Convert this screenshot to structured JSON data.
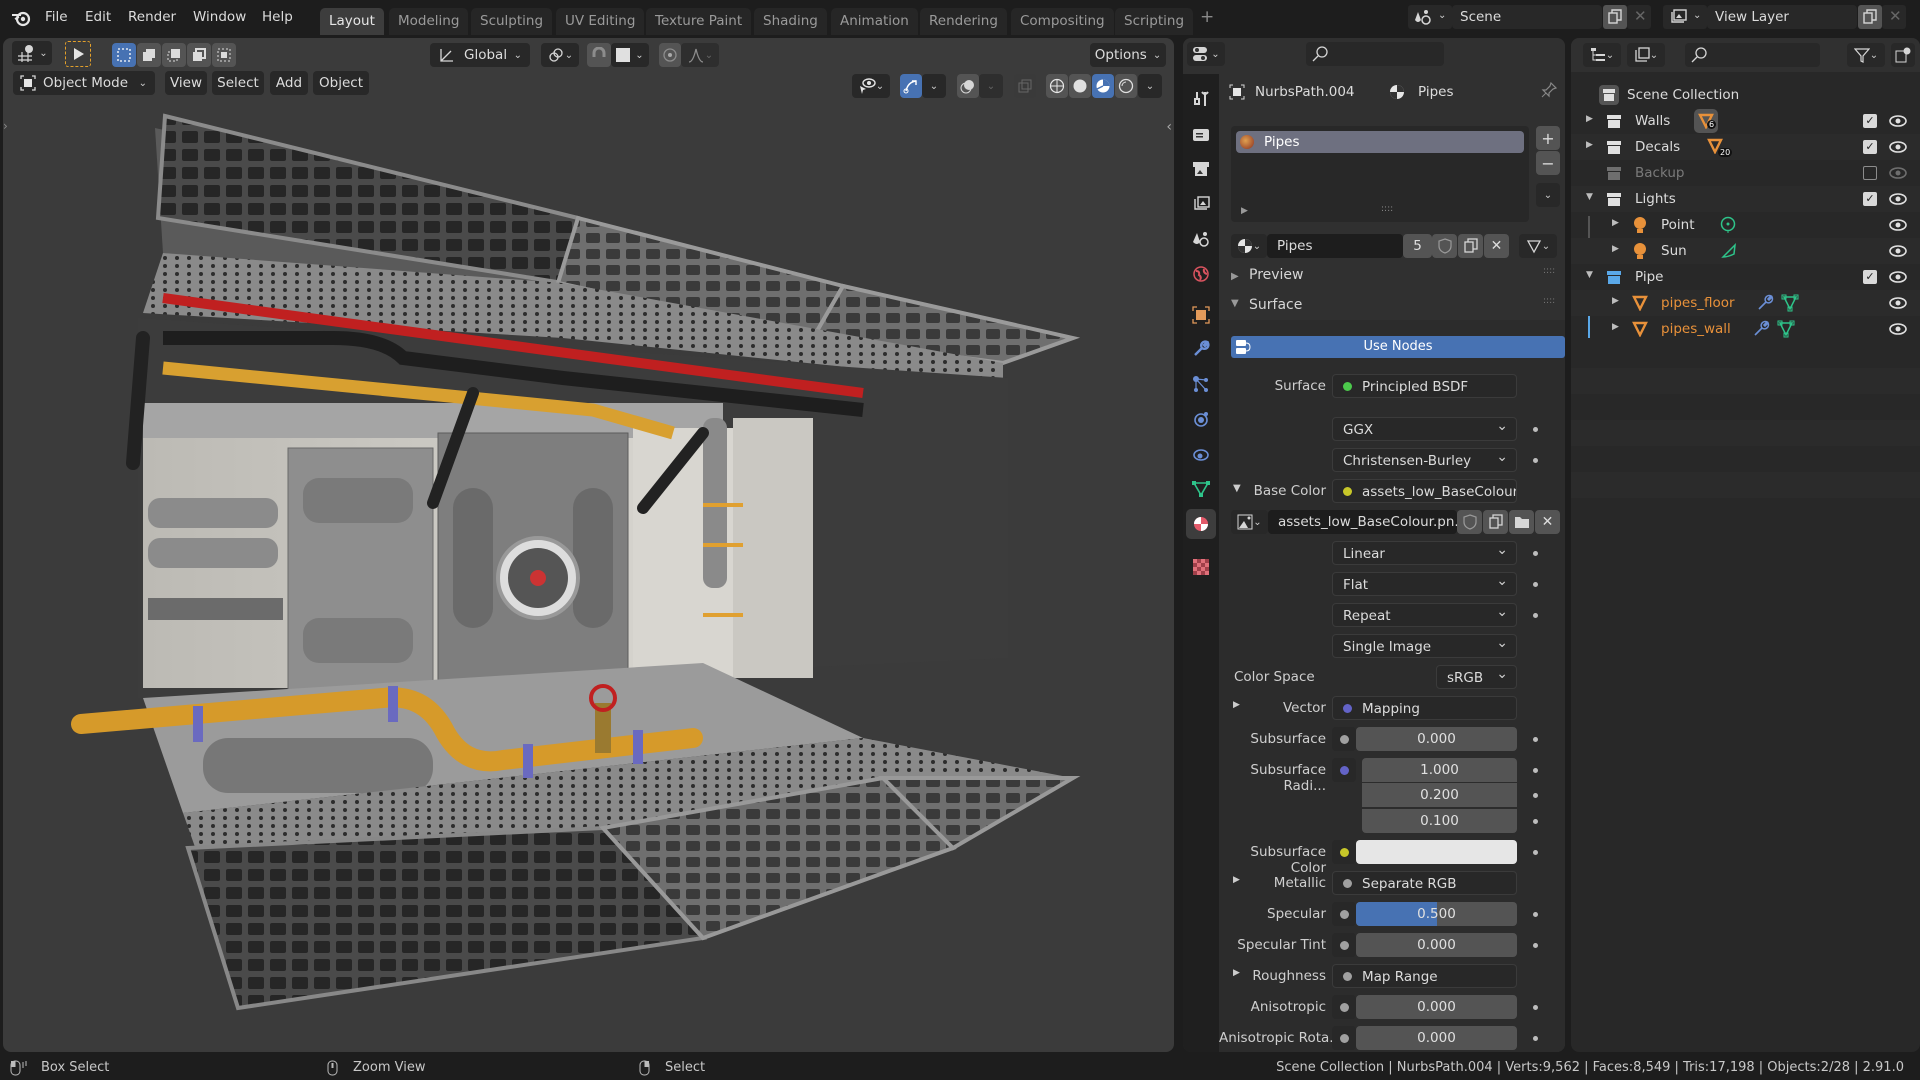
{
  "app": {
    "name": "Blender",
    "version": "2.91.0"
  },
  "menu": [
    "File",
    "Edit",
    "Render",
    "Window",
    "Help"
  ],
  "workspaces": [
    {
      "label": "Layout",
      "active": true
    },
    {
      "label": "Modeling"
    },
    {
      "label": "Sculpting"
    },
    {
      "label": "UV Editing"
    },
    {
      "label": "Texture Paint"
    },
    {
      "label": "Shading"
    },
    {
      "label": "Animation"
    },
    {
      "label": "Rendering"
    },
    {
      "label": "Compositing"
    },
    {
      "label": "Scripting"
    }
  ],
  "add_workspace": "+",
  "scene": {
    "name": "Scene",
    "view_layer": "View Layer"
  },
  "viewport": {
    "transform_orientation": "Global",
    "options_label": "Options",
    "mode": "Object Mode",
    "menus": [
      "View",
      "Select",
      "Add",
      "Object"
    ],
    "shading_active": "material-preview"
  },
  "properties": {
    "search_placeholder": "",
    "breadcrumb": {
      "object": "NurbsPath.004",
      "material": "Pipes"
    },
    "material_slots": [
      "Pipes"
    ],
    "material_name": "Pipes",
    "users": "5",
    "sections": {
      "preview": "Preview",
      "surface": "Surface"
    },
    "use_nodes": "Use Nodes",
    "rows": {
      "surface": {
        "label": "Surface",
        "value": "Principled BSDF",
        "socket": "#4cc94c"
      },
      "distribution": "GGX",
      "subsurface_method": "Christensen-Burley",
      "base_color": {
        "label": "Base Color",
        "value": "assets_low_BaseColour....",
        "socket": "#c7c729"
      },
      "image": "assets_low_BaseColour.pn...",
      "interpolation": "Linear",
      "projection": "Flat",
      "extension": "Repeat",
      "source": "Single Image",
      "color_space": {
        "label": "Color Space",
        "value": "sRGB"
      },
      "vector": {
        "label": "Vector",
        "value": "Mapping",
        "socket": "#6363c7"
      },
      "subsurface": {
        "label": "Subsurface",
        "value": "0.000"
      },
      "subsurface_radius": {
        "label": "Subsurface Radi...",
        "values": [
          "1.000",
          "0.200",
          "0.100"
        ]
      },
      "subsurface_color": {
        "label": "Subsurface Color",
        "value": "#e6e6e6"
      },
      "metallic": {
        "label": "Metallic",
        "value": "Separate RGB"
      },
      "specular": {
        "label": "Specular",
        "value": "0.500",
        "fill": 0.5
      },
      "specular_tint": {
        "label": "Specular Tint",
        "value": "0.000"
      },
      "roughness": {
        "label": "Roughness",
        "value": "Map Range"
      },
      "anisotropic": {
        "label": "Anisotropic",
        "value": "0.000"
      },
      "anisotropic_rotation": {
        "label": "Anisotropic Rota...",
        "value": "0.000"
      }
    }
  },
  "outliner": {
    "root": "Scene Collection",
    "items": [
      {
        "name": "Walls",
        "type": "collection",
        "badge": "6",
        "checked": true
      },
      {
        "name": "Decals",
        "type": "collection",
        "badge": "20",
        "checked": true
      },
      {
        "name": "Backup",
        "type": "collection",
        "checked": false,
        "disabled": true
      },
      {
        "name": "Lights",
        "type": "collection",
        "checked": true,
        "expanded": true
      },
      {
        "name": "Point",
        "type": "light"
      },
      {
        "name": "Sun",
        "type": "light"
      },
      {
        "name": "Pipe",
        "type": "collection",
        "checked": true,
        "expanded": true
      },
      {
        "name": "pipes_floor",
        "type": "object"
      },
      {
        "name": "pipes_wall",
        "type": "object"
      }
    ]
  },
  "statusbar": {
    "left": [
      {
        "label": "Box Select",
        "icon": "mouse-left-drag-icon"
      },
      {
        "label": "Zoom View",
        "icon": "mouse-middle-icon"
      },
      {
        "label": "Select",
        "icon": "mouse-right-icon"
      }
    ],
    "stats": "Scene Collection | NurbsPath.004 | Verts:9,562 | Faces:8,549 | Tris:17,198 | Objects:2/28 | 2.91.0"
  },
  "colors": {
    "accent": "#4772b3",
    "object_orange": "#e8913a",
    "modifier_blue": "#6b8fd6",
    "data_green": "#2ec48a"
  }
}
